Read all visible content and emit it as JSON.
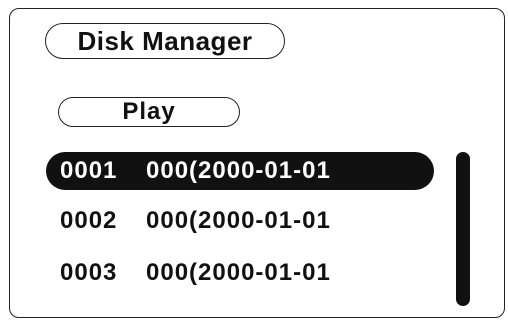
{
  "header": {
    "title": "Disk Manager"
  },
  "actions": {
    "play_label": "Play"
  },
  "files": [
    {
      "index": "0001",
      "name": "000(2000-01-01",
      "selected": true
    },
    {
      "index": "0002",
      "name": "000(2000-01-01",
      "selected": false
    },
    {
      "index": "0003",
      "name": "000(2000-01-01",
      "selected": false
    }
  ],
  "colors": {
    "background": "#ffffff",
    "foreground": "#111111",
    "selection": "#111111",
    "selection_text": "#ffffff"
  }
}
